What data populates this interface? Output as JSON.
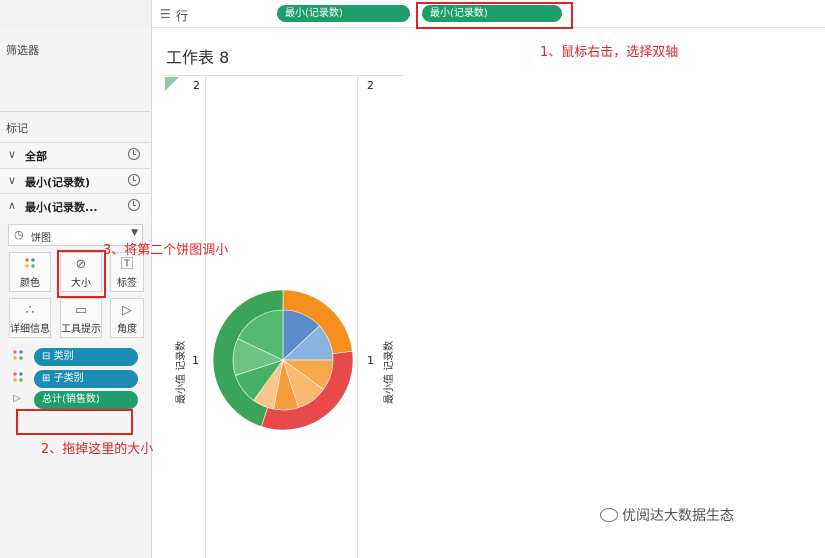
{
  "toolbar": {
    "rows_label": "行",
    "rows_icon": "rows-icon",
    "pill1": "最小(记录数)",
    "pill2": "最小(记录数)"
  },
  "sidebar": {
    "filters_title": "筛选器",
    "marks_title": "标记",
    "mark_rows": [
      {
        "label": "全部",
        "expanded": false
      },
      {
        "label": "最小(记录数)",
        "expanded": false
      },
      {
        "label": "最小(记录数...",
        "expanded": true
      }
    ],
    "mark_type": "饼图",
    "cards": {
      "color": "颜色",
      "size": "大小",
      "label": "标签",
      "detail": "详细信息",
      "tooltip": "工具提示",
      "angle": "角度"
    },
    "fields": [
      {
        "label": "类别",
        "icon": "color-dots-icon",
        "prefix": "⊟"
      },
      {
        "label": "子类别",
        "icon": "color-dots-icon",
        "prefix": "⊞"
      },
      {
        "label": "总计(销售数)",
        "icon": "angle-icon",
        "prefix": ""
      }
    ]
  },
  "sheet": {
    "title": "工作表 8",
    "axis_top_left": "2",
    "axis_top_right": "2",
    "axis_mid_left": "1",
    "axis_mid_right": "1",
    "axis_title_left": "最小值 记录数",
    "axis_title_right": "最小值 记录数"
  },
  "annotations": {
    "step1": "1、鼠标右击，选择双轴",
    "step2": "2、拖掉这里的大小",
    "step3": "3、将第二个饼图调小"
  },
  "watermark": "优阅达大数据生态",
  "colors": {
    "accent_green": "#1e9e6a",
    "accent_blue": "#1b8db5",
    "annotation_red": "#e02424"
  },
  "pie": {
    "outer": [
      {
        "value": 0.23,
        "color": "#f5901e"
      },
      {
        "value": 0.32,
        "color": "#e84a4a"
      },
      {
        "value": 0.45,
        "color": "#3aa558"
      }
    ],
    "inner": [
      {
        "value": 0.13,
        "color": "#5d8ac8"
      },
      {
        "value": 0.12,
        "color": "#8ab4e0"
      },
      {
        "value": 0.1,
        "color": "#f7a84a"
      },
      {
        "value": 0.1,
        "color": "#fab870"
      },
      {
        "value": 0.08,
        "color": "#f39c3b"
      },
      {
        "value": 0.07,
        "color": "#f9c58a"
      },
      {
        "value": 0.1,
        "color": "#47b065"
      },
      {
        "value": 0.12,
        "color": "#6cc47e"
      },
      {
        "value": 0.18,
        "color": "#55b970"
      }
    ]
  }
}
